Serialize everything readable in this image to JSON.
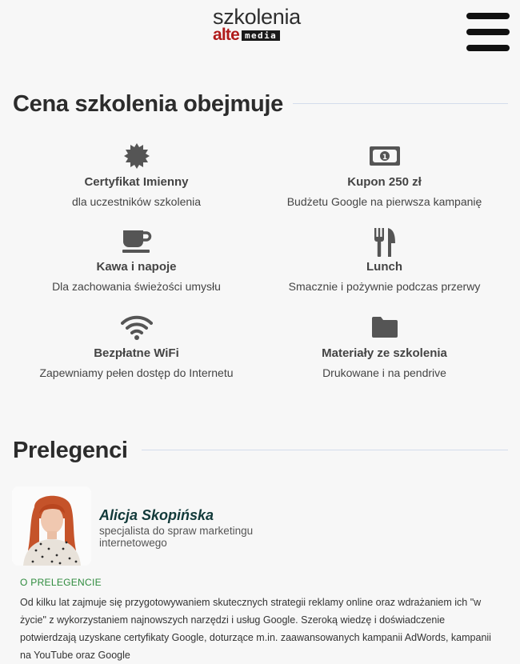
{
  "logo": {
    "top": "szkolenia",
    "brand": "alte",
    "media": "media"
  },
  "menu": {
    "icon": "hamburger-menu-icon"
  },
  "pricing": {
    "title": "Cena szkolenia obejmuje",
    "items": [
      {
        "icon": "certificate-badge-icon",
        "title": "Certyfikat Imienny",
        "desc": "dla uczestników szkolenia"
      },
      {
        "icon": "banknote-icon",
        "title": "Kupon 250 zł",
        "desc": "Budżetu Google na pierwsza kampanię"
      },
      {
        "icon": "coffee-cup-icon",
        "title": "Kawa i napoje",
        "desc": "Dla zachowania świeżości umysłu"
      },
      {
        "icon": "fork-knife-icon",
        "title": "Lunch",
        "desc": "Smacznie i pożywnie podczas przerwy"
      },
      {
        "icon": "wifi-icon",
        "title": "Bezpłatne WiFi",
        "desc": "Zapewniamy pełen dostęp do Internetu"
      },
      {
        "icon": "folder-icon",
        "title": "Materiały ze szkolenia",
        "desc": "Drukowane i na pendrive"
      }
    ]
  },
  "speakers": {
    "title": "Prelegenci",
    "speaker": {
      "name": "Alicja Skopińska",
      "role": "specjalista do spraw marketingu internetowego",
      "about_label": "O PRELEGENCIE",
      "bio": "Od kilku lat zajmuje się przygotowywaniem skutecznych strategii reklamy online oraz wdrażaniem ich \"w życie\" z wykorzystaniem najnowszych narzędzi i usług Google. Szeroką wiedzę i doświadczenie potwierdzają uzyskane certyfikaty Google, doturzące m.in. zaawansowanych kampanii AdWords, kampanii na YouTube oraz Google"
    }
  },
  "colors": {
    "accent_green": "#2e8b3d",
    "brand_red": "#b01a1a",
    "icon_gray": "#555555"
  }
}
